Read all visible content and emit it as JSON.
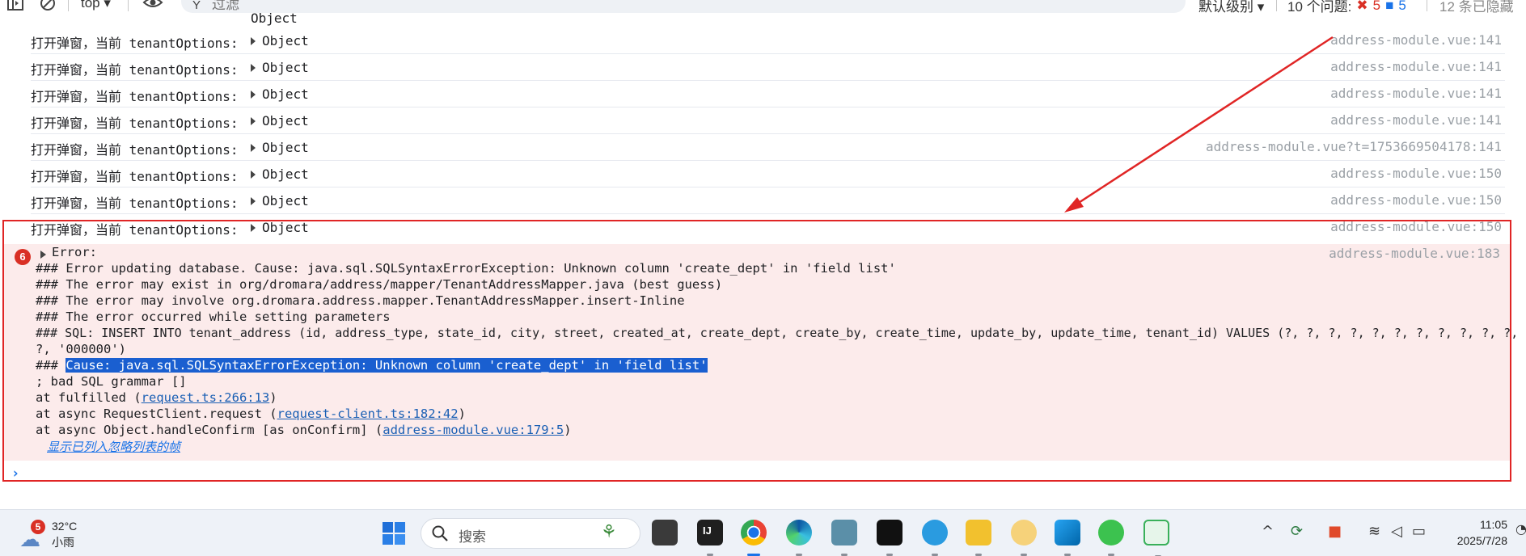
{
  "toolbar": {
    "context": "top",
    "context_arrow": "▾",
    "filter_placeholder": "过滤",
    "levels": "默认级别 ▾",
    "issues_label": "10 个问题:",
    "issues_errors": "5",
    "issues_info": "5",
    "hidden_count": "12 条已隐藏"
  },
  "top_partial": "Object",
  "console_rows": [
    {
      "message": "打开弹窗，当前 tenantOptions:",
      "object": "Object",
      "source": "address-module.vue:141"
    },
    {
      "message": "打开弹窗，当前 tenantOptions:",
      "object": "Object",
      "source": "address-module.vue:141"
    },
    {
      "message": "打开弹窗，当前 tenantOptions:",
      "object": "Object",
      "source": "address-module.vue:141"
    },
    {
      "message": "打开弹窗，当前 tenantOptions:",
      "object": "Object",
      "source": "address-module.vue:141"
    },
    {
      "message": "打开弹窗，当前 tenantOptions:",
      "object": "Object",
      "source": "address-module.vue?t=1753669504178:141"
    },
    {
      "message": "打开弹窗，当前 tenantOptions:",
      "object": "Object",
      "source": "address-module.vue:150"
    },
    {
      "message": "打开弹窗，当前 tenantOptions:",
      "object": "Object",
      "source": "address-module.vue:150"
    },
    {
      "message": "打开弹窗，当前 tenantOptions:",
      "object": "Object",
      "source": "address-module.vue:150"
    }
  ],
  "error": {
    "count": "6",
    "title": "Error:",
    "source": "address-module.vue:183",
    "line1": "### Error updating database.  Cause: java.sql.SQLSyntaxErrorException: Unknown column 'create_dept' in 'field list'",
    "line2": "### The error may exist in org/dromara/address/mapper/TenantAddressMapper.java (best guess)",
    "line3": "### The error may involve org.dromara.address.mapper.TenantAddressMapper.insert-Inline",
    "line4": "### The error occurred while setting parameters",
    "line5": "### SQL: INSERT INTO tenant_address (id, address_type, state_id, city, street, created_at, create_dept, create_by, create_time, update_by, update_time, tenant_id) VALUES (?, ?, ?, ?, ?, ?, ?, ?, ?, ?, ?,",
    "line6": "?, '000000')",
    "line7_prefix": "### ",
    "line7_highlight": "Cause: java.sql.SQLSyntaxErrorException: Unknown column 'create_dept' in 'field list'",
    "line8": "; bad SQL grammar []",
    "stack1_prefix": "    at fulfilled (",
    "stack1_link": "request.ts:266:13",
    "stack1_suffix": ")",
    "stack2_prefix": "    at async RequestClient.request (",
    "stack2_link": "request-client.ts:182:42",
    "stack2_suffix": ")",
    "stack3_prefix": "    at async Object.handleConfirm [as onConfirm] (",
    "stack3_link": "address-module.vue:179:5",
    "stack3_suffix": ")",
    "ignored_link": "显示已列入忽略列表的帧"
  },
  "prompt": "›",
  "annotation": {
    "color": "#e02525"
  },
  "taskbar": {
    "weather_badge": "5",
    "temperature": "32°C",
    "condition": "小雨",
    "search_text": "搜索",
    "time": "11:05",
    "date": "2025/7/28"
  }
}
